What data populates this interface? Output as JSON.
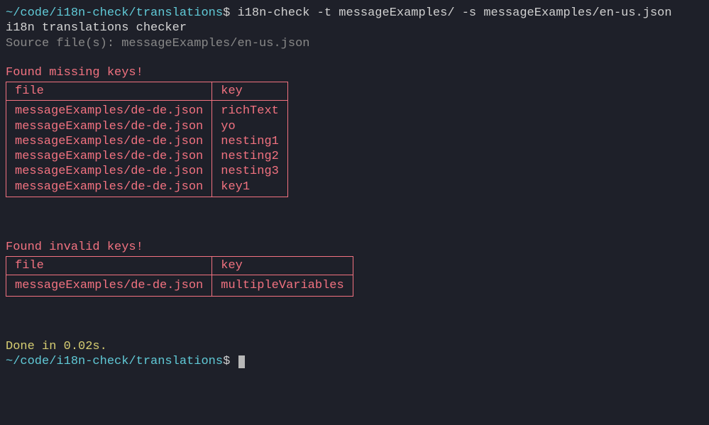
{
  "prompt": {
    "path": "~/code/i18n-check/translations",
    "dollar": "$"
  },
  "command": "i18n-check -t messageExamples/ -s messageExamples/en-us.json",
  "output": {
    "title": "i18n translations checker",
    "source_line": "Source file(s): messageExamples/en-us.json",
    "missing": {
      "heading": "Found missing keys!",
      "headers": {
        "file": "file",
        "key": "key"
      },
      "rows": [
        {
          "file": "messageExamples/de-de.json",
          "key": "richText"
        },
        {
          "file": "messageExamples/de-de.json",
          "key": "yo"
        },
        {
          "file": "messageExamples/de-de.json",
          "key": "nesting1"
        },
        {
          "file": "messageExamples/de-de.json",
          "key": "nesting2"
        },
        {
          "file": "messageExamples/de-de.json",
          "key": "nesting3"
        },
        {
          "file": "messageExamples/de-de.json",
          "key": "key1"
        }
      ]
    },
    "invalid": {
      "heading": "Found invalid keys!",
      "headers": {
        "file": "file",
        "key": "key"
      },
      "rows": [
        {
          "file": "messageExamples/de-de.json",
          "key": "multipleVariables"
        }
      ]
    },
    "done": "Done in 0.02s."
  }
}
